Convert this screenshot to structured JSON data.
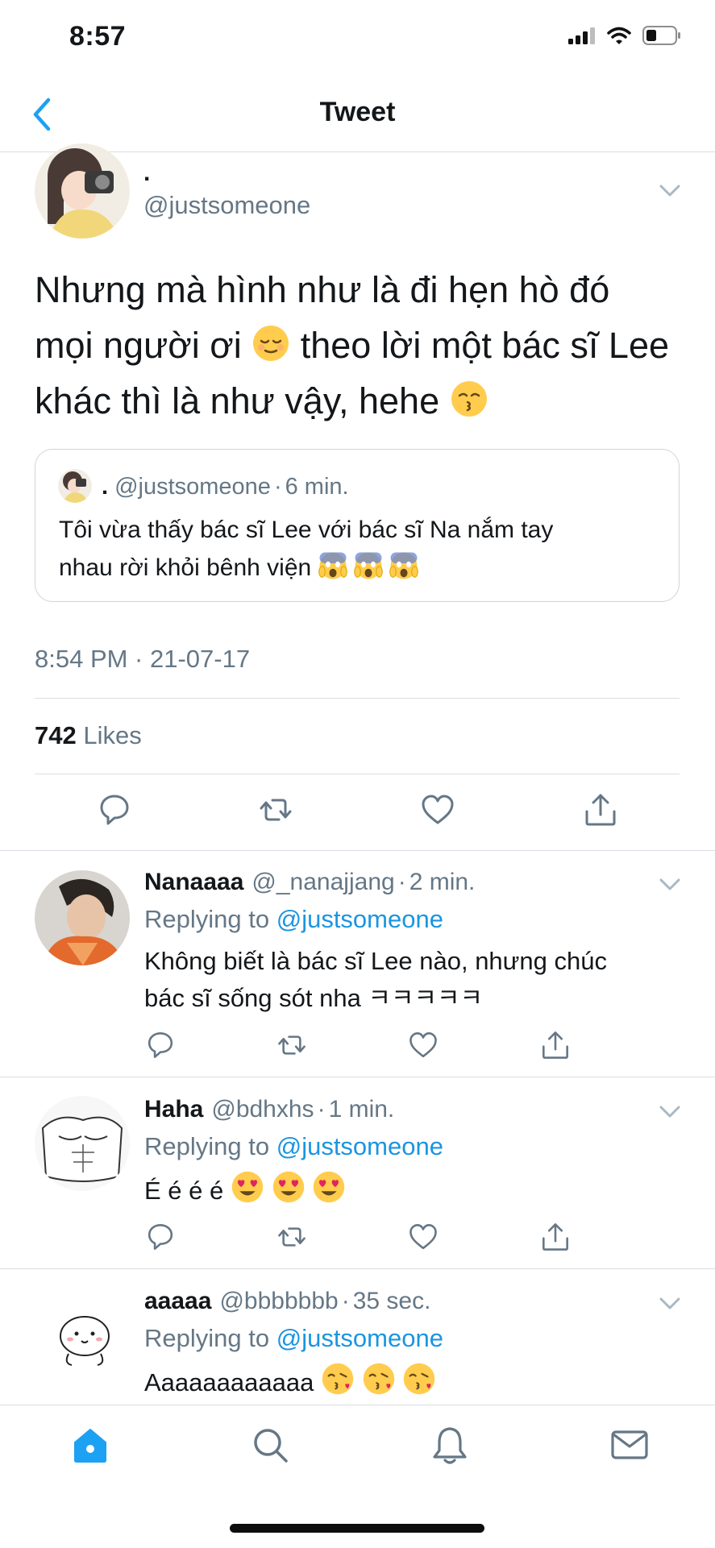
{
  "status_bar": {
    "time": "8:57"
  },
  "nav": {
    "title": "Tweet"
  },
  "main_tweet": {
    "name": ".",
    "handle": "@justsomeone",
    "text_lines": [
      "Nhưng mà hình như là đi hẹn hò đó",
      "mọi người ơi",
      "theo lời một bác sĩ Lee",
      "khác thì là như vậy, hehe"
    ],
    "quote": {
      "name": ".",
      "handle": "@justsomeone",
      "separator": "·",
      "time": "6 min.",
      "text_line1": "Tôi vừa thấy bác sĩ Lee với bác sĩ Na nắm tay",
      "text_line2": "nhau rời khỏi bênh viện"
    },
    "timestamp": "8:54 PM · 21-07-17",
    "likes_count": "742",
    "likes_label": "Likes"
  },
  "replies": [
    {
      "name": "Nanaaaa",
      "handle": "@_nanajjang",
      "time": "2 min.",
      "replying_to_label": "Replying to",
      "replying_to": "@justsomeone",
      "text_line1": "Không biết là bác sĩ Lee nào, nhưng chúc",
      "text_line2": "bác sĩ sống sót nha ㅋㅋㅋㅋㅋ"
    },
    {
      "name": "Haha",
      "handle": "@bdhxhs",
      "time": "1 min.",
      "replying_to_label": "Replying to",
      "replying_to": "@justsomeone",
      "text": "É é é é"
    },
    {
      "name": "aaaaa",
      "handle": "@bbbbbbb",
      "time": "35 sec.",
      "replying_to_label": "Replying to",
      "replying_to": "@justsomeone",
      "text": "Aaaaaaaaaaaa"
    }
  ],
  "icons": {
    "action_bar": [
      "reply-icon",
      "retweet-icon",
      "like-icon",
      "share-icon"
    ],
    "tab_bar": [
      "home-icon",
      "search-icon",
      "notifications-icon",
      "messages-icon"
    ]
  },
  "colors": {
    "accent": "#1da1f2",
    "link": "#1b95e0",
    "secondary_text": "#657786",
    "divider": "#d9dee2"
  }
}
